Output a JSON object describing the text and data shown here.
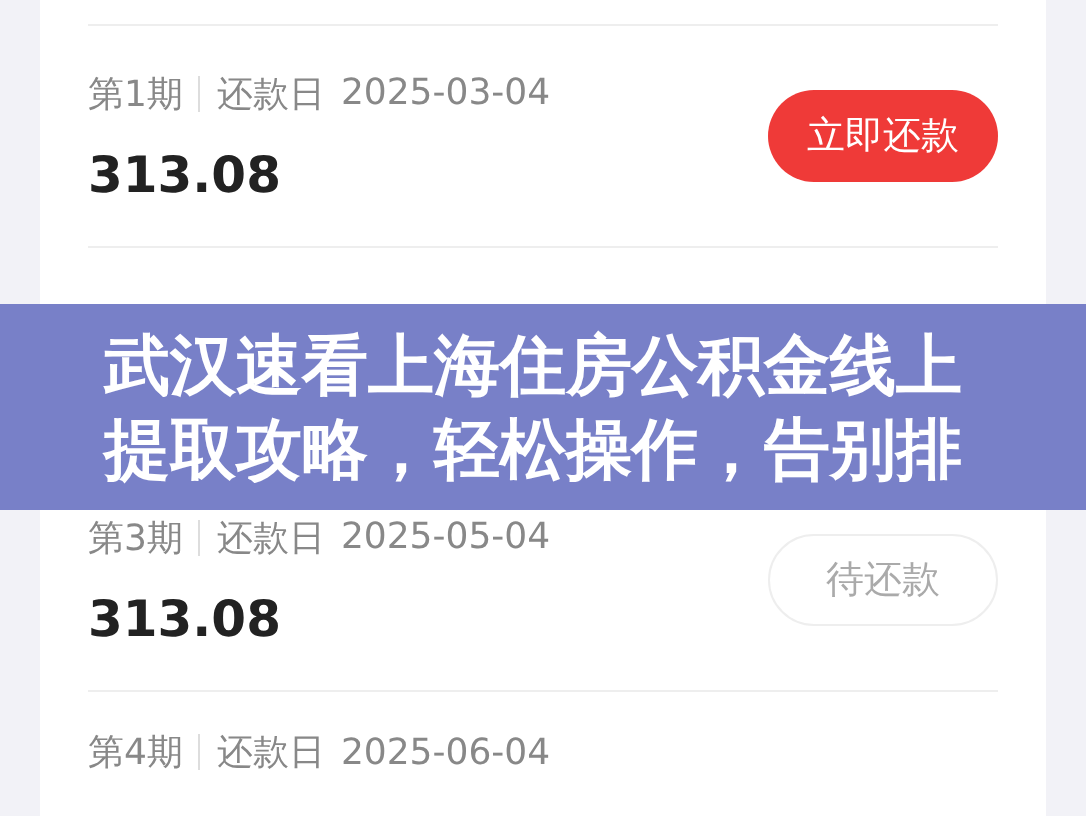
{
  "installments": [
    {
      "period": "第1期",
      "due_label": "还款日",
      "due_date": "2025-03-04",
      "amount": "313.08",
      "action": {
        "kind": "pay",
        "label": "立即还款"
      }
    },
    {
      "period": "第3期",
      "due_label": "还款日",
      "due_date": "2025-05-04",
      "amount": "313.08",
      "action": {
        "kind": "pending",
        "label": "待还款"
      }
    },
    {
      "period": "第4期",
      "due_label": "还款日",
      "due_date": "2025-06-04"
    }
  ],
  "banner": {
    "lines": [
      "武汉速看上海住房公积金线上",
      "提取攻略，轻松操作，告别排"
    ]
  }
}
